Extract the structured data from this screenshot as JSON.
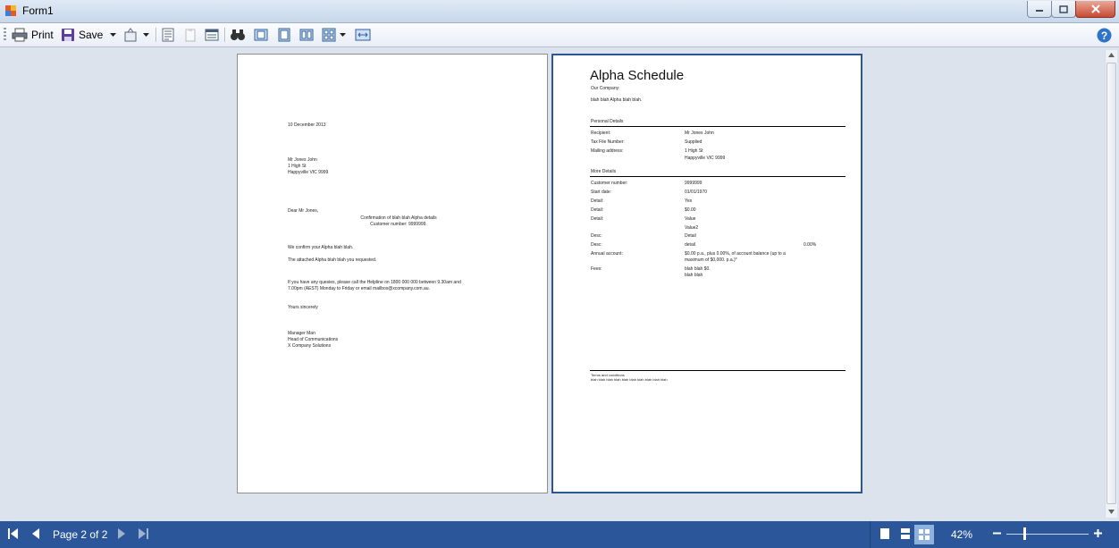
{
  "window": {
    "title": "Form1"
  },
  "toolbar": {
    "print_label": "Print",
    "save_label": "Save"
  },
  "status": {
    "page_text": "Page 2 of 2",
    "zoom": "42%",
    "zoom_level_fraction": 0.42
  },
  "letter": {
    "date": "10 December 2013",
    "address_name": "Mr Jones John",
    "address_line1": "1 High St",
    "address_line2": "Happyville VIC 9999",
    "salutation": "Dear Mr Jones,",
    "subject": "Confirmation of blah blah Alpha details",
    "customer_number_line": "Customer number: 9999999.",
    "para1": "We confirm your Alpha blah blah.",
    "para2": "The attached Alpha blah blah you requested.",
    "para3_line1": "If you have any quesies, please call the Helpline on 1800 000 000 between 9.30am and",
    "para3_line2": "7.00pm (AEST) Monday to Friday or email mailbox@xcompany.com.au.",
    "closing": "Yours sincerely",
    "signer_name": "Manager Man",
    "signer_title": "Head of Communications",
    "signer_company": "X Company Solutions"
  },
  "schedule": {
    "title": "Alpha Schedule",
    "company_label": "Our Company:",
    "company_text": "blah blah Alpha blah blah.",
    "section1_heading": "Personal Details",
    "recipient_label": "Recipient:",
    "recipient_value": "Mr Jones John",
    "tfn_label": "Tax File Number:",
    "tfn_value": "Supplied",
    "mailing_label": "Mailing address:",
    "mailing_value1": "1 High St",
    "mailing_value2": "Happyville VIC 9999",
    "section2_heading": "More Details",
    "customer_label": "Customer number:",
    "customer_value": "9999999",
    "start_label": "Start date:",
    "start_value": "01/01/1970",
    "detail1_label": "Detail:",
    "detail1_value": "Yes",
    "detail2_label": "Detail:",
    "detail2_value": "$0.00",
    "detail3_label": "Detail:",
    "detail3_value": "Value",
    "detail3_value2": "Value2",
    "desc1_label": "Desc:",
    "desc1_value": "Detail",
    "desc2_label": "Desc:",
    "desc2_value": "detail",
    "desc2_extra": "0.00%",
    "annual_label": "Annual account:",
    "annual_value1": "$0.00 p.a., plus 0.00%, of account balance (up to a",
    "annual_value2": "maximum of $0,000. p.a.)*",
    "fees_label": "Fees:",
    "fees_value1": "blah blah $0.",
    "fees_value2": "blah blah",
    "footer_heading": "Terms and conditions",
    "footer_text": "blah blah blah blah blah blah blah blah blah blah"
  }
}
